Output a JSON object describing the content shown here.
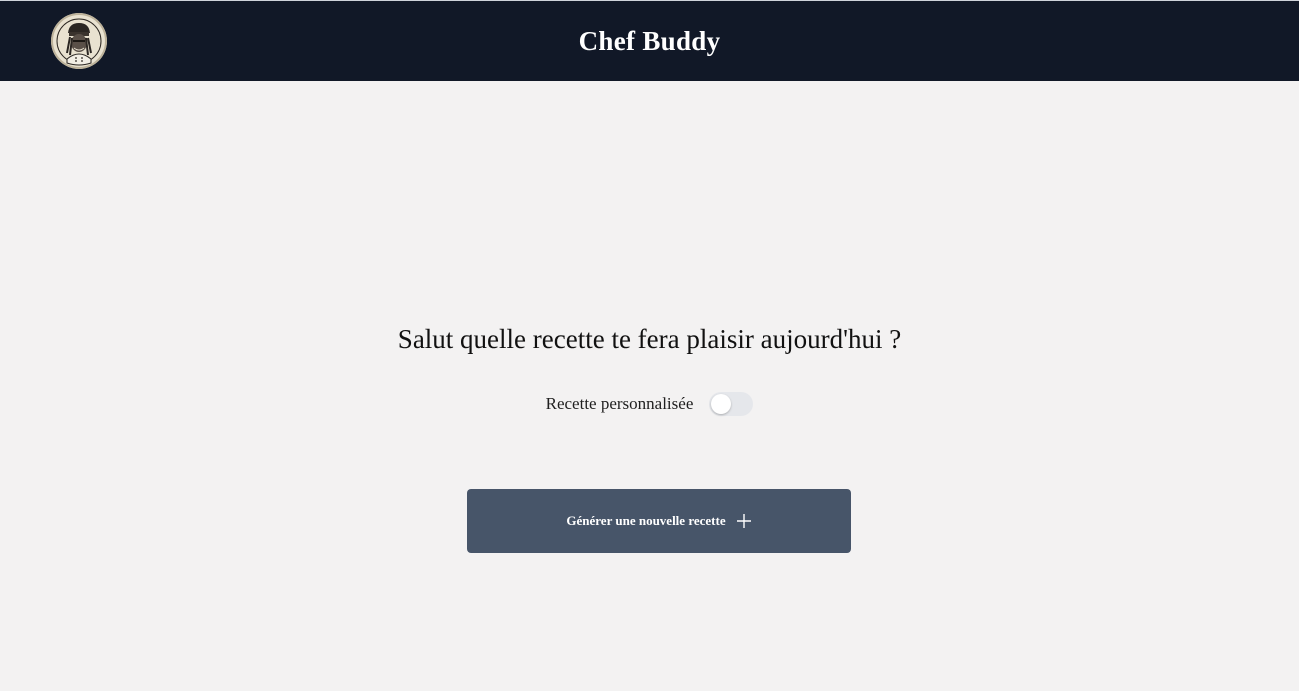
{
  "header": {
    "title": "Chef Buddy",
    "background": "#111827",
    "logo_icon": "chef-portrait-logo"
  },
  "main": {
    "greeting": "Salut quelle recette te fera plaisir aujourd'hui ?",
    "custom_recipe_toggle": {
      "label": "Recette personnalisée",
      "checked": false
    },
    "generate_button": {
      "label": "Générer une nouvelle recette",
      "icon": "plus-icon",
      "background": "#475569"
    }
  }
}
